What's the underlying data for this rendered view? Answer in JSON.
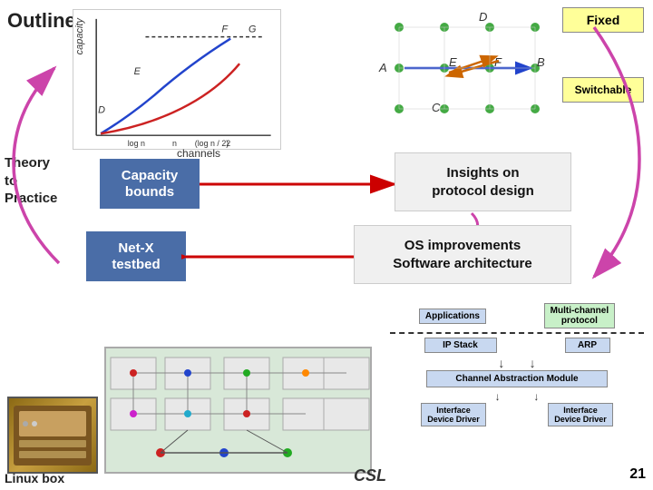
{
  "slide": {
    "title": "Outline",
    "theory_label": "Theory\nto\nPractice",
    "capacity_vertical": "capacity",
    "channels_label": "channels",
    "capacity_bounds_label": "Capacity\nbounds",
    "insights_label": "Insights on\nprotocol design",
    "os_label": "OS improvements\nSoftware architecture",
    "netx_label": "Net-X\ntestbed",
    "fixed_label": "Fixed",
    "switchable_label": "Switchable",
    "applications_label": "Applications",
    "multi_channel_label": "Multi-channel\nprotocol",
    "ip_stack_label": "IP Stack",
    "arp_label": "ARP",
    "channel_abstraction_label": "Channel Abstraction Module",
    "interface1_label": "Interface\nDevice Driver",
    "interface2_label": "Interface\nDevice Driver",
    "linux_label": "Linux box",
    "csl_label": "CSL",
    "page_number": "21",
    "colors": {
      "blue_box": "#4a6da7",
      "light_box": "#f0f0f0",
      "yellow_label": "#ffff99",
      "proto_blue": "#c8d8f0",
      "proto_green": "#c8f0c8"
    }
  }
}
